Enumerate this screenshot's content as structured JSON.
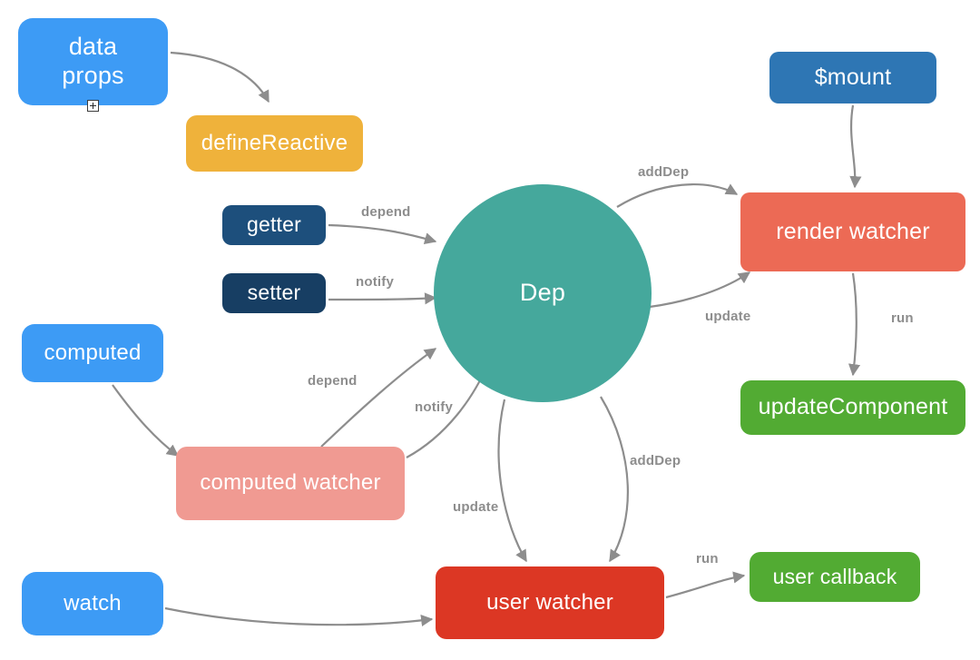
{
  "diagram": {
    "title": "Vue reactivity dependency flow diagram",
    "background": "#ffffff",
    "edge_color": "#8d8d8d",
    "nodes": [
      {
        "id": "data",
        "label": "data\nprops",
        "color": "#3d9bf5",
        "shape": "rounded-rect"
      },
      {
        "id": "defineReactive",
        "label": "defineReactive",
        "color": "#efb23b",
        "shape": "rounded-rect"
      },
      {
        "id": "getter",
        "label": "getter",
        "color": "#1d4f7c",
        "shape": "rounded-rect"
      },
      {
        "id": "setter",
        "label": "setter",
        "color": "#173e63",
        "shape": "rounded-rect"
      },
      {
        "id": "computed",
        "label": "computed",
        "color": "#3d9bf5",
        "shape": "rounded-rect"
      },
      {
        "id": "watch",
        "label": "watch",
        "color": "#3d9bf5",
        "shape": "rounded-rect"
      },
      {
        "id": "computedWatcher",
        "label": "computed watcher",
        "color": "#f09a92",
        "shape": "rounded-rect"
      },
      {
        "id": "dep",
        "label": "Dep",
        "color": "#45a89c",
        "shape": "circle"
      },
      {
        "id": "userWatcher",
        "label": "user watcher",
        "color": "#dc3724",
        "shape": "rounded-rect"
      },
      {
        "id": "mount",
        "label": "$mount",
        "color": "#2e76b4",
        "shape": "rounded-rect"
      },
      {
        "id": "renderWatcher",
        "label": "render watcher",
        "color": "#ec6a55",
        "shape": "rounded-rect"
      },
      {
        "id": "updateComponent",
        "label": "updateComponent",
        "color": "#52ab33",
        "shape": "rounded-rect"
      },
      {
        "id": "userCallback",
        "label": "user callback",
        "color": "#52ab33",
        "shape": "rounded-rect"
      }
    ],
    "node_labels": {
      "data_line1": "data",
      "data_line2": "props",
      "defineReactive": "defineReactive",
      "getter": "getter",
      "setter": "setter",
      "computed": "computed",
      "watch": "watch",
      "computedWatcher": "computed watcher",
      "dep": "Dep",
      "userWatcher": "user watcher",
      "mount": "$mount",
      "renderWatcher": "render watcher",
      "updateComponent": "updateComponent",
      "userCallback": "user callback"
    },
    "edges": [
      {
        "from": "data",
        "to": "defineReactive",
        "label": ""
      },
      {
        "from": "getter",
        "to": "dep",
        "label": "depend"
      },
      {
        "from": "setter",
        "to": "dep",
        "label": "notify"
      },
      {
        "from": "computed",
        "to": "computedWatcher",
        "label": ""
      },
      {
        "from": "computedWatcher",
        "to": "dep",
        "label": "depend"
      },
      {
        "from": "computedWatcher",
        "to": "dep",
        "label": "notify"
      },
      {
        "from": "dep",
        "to": "renderWatcher",
        "label": "addDep"
      },
      {
        "from": "dep",
        "to": "renderWatcher",
        "label": "update"
      },
      {
        "from": "dep",
        "to": "userWatcher",
        "label": "update"
      },
      {
        "from": "dep",
        "to": "userWatcher",
        "label": "addDep"
      },
      {
        "from": "mount",
        "to": "renderWatcher",
        "label": ""
      },
      {
        "from": "renderWatcher",
        "to": "updateComponent",
        "label": "run"
      },
      {
        "from": "watch",
        "to": "userWatcher",
        "label": ""
      },
      {
        "from": "userWatcher",
        "to": "userCallback",
        "label": "run"
      }
    ],
    "edge_labels": {
      "depend_getter": "depend",
      "notify_setter": "notify",
      "depend_computed": "depend",
      "notify_computed": "notify",
      "addDep_render": "addDep",
      "update_render": "update",
      "run_render": "run",
      "update_user": "update",
      "addDep_user": "addDep",
      "run_user": "run"
    },
    "controls": {
      "expander_icon": "plus-square-icon"
    }
  }
}
